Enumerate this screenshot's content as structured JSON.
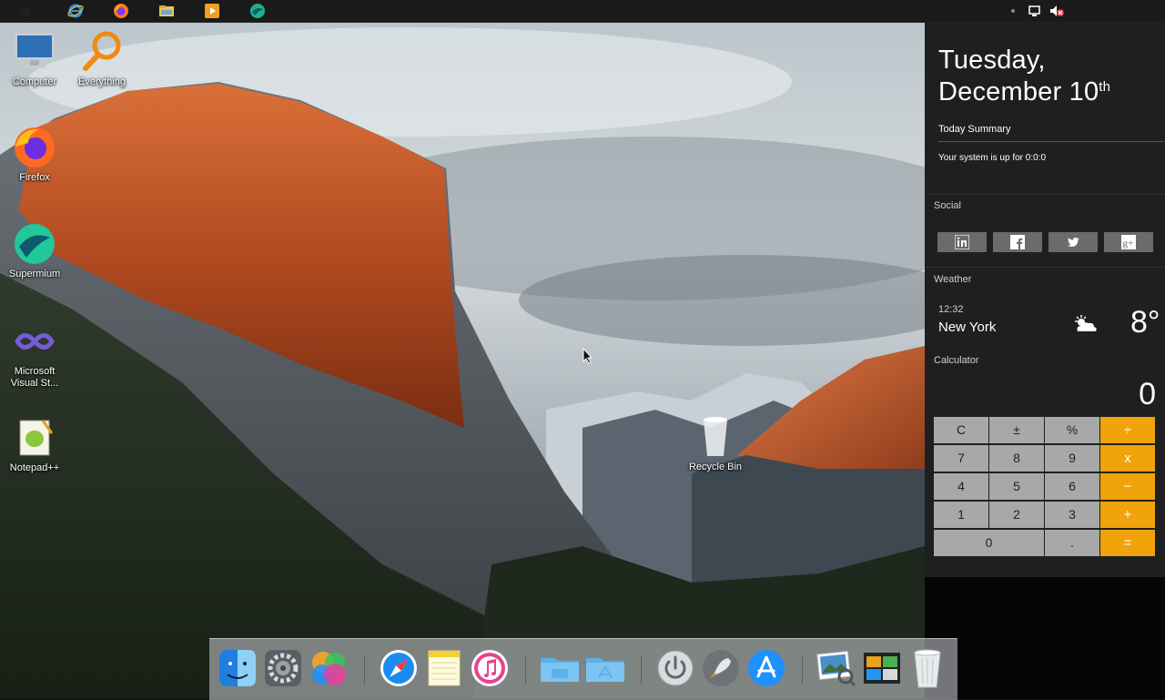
{
  "topbar": {
    "icons": [
      "windows-icon",
      "internet-explorer-icon",
      "firefox-icon",
      "file-explorer-icon",
      "media-player-icon",
      "supermium-icon"
    ],
    "tray_icons": [
      "notification-dot-icon",
      "network-icon",
      "volume-muted-icon"
    ]
  },
  "desktop": {
    "icons": [
      {
        "label": "Computer"
      },
      {
        "label": "Everything"
      },
      {
        "label": "Firefox"
      },
      {
        "label": "Supermium"
      },
      {
        "label": "Microsoft\nVisual St..."
      },
      {
        "label": "Notepad++"
      },
      {
        "label": "Recycle Bin"
      }
    ]
  },
  "panel": {
    "date": {
      "weekday": "Tuesday,",
      "month_day": "December 10",
      "suffix": "th"
    },
    "summary": {
      "title": "Today Summary",
      "text": "Your system is up for 0:0:0"
    },
    "social": {
      "title": "Social",
      "buttons": [
        "linkedin-icon",
        "facebook-icon",
        "twitter-icon",
        "google-plus-icon"
      ]
    },
    "weather": {
      "title": "Weather",
      "time": "12:32",
      "city": "New York",
      "temp": "8°",
      "icon": "partly-cloudy-icon"
    },
    "calculator": {
      "title": "Calculator",
      "display": "0",
      "keys": [
        "C",
        "±",
        "%",
        "÷",
        "7",
        "8",
        "9",
        "x",
        "4",
        "5",
        "6",
        "−",
        "1",
        "2",
        "3",
        "+",
        "0",
        ".",
        "="
      ]
    }
  },
  "dock": {
    "items": [
      "finder-icon",
      "system-preferences-icon",
      "game-center-icon",
      "safari-icon",
      "notes-icon",
      "itunes-icon",
      "folder-icon",
      "applications-folder-icon",
      "power-icon",
      "launchpad-icon",
      "app-store-icon",
      "preview-icon",
      "photo-gallery-icon",
      "trash-icon"
    ]
  },
  "colors": {
    "accent": "#f0a30a",
    "panel_bg": "#1e2020",
    "key_bg": "#a7a9a9",
    "social_btn": "#6a6c6c"
  }
}
